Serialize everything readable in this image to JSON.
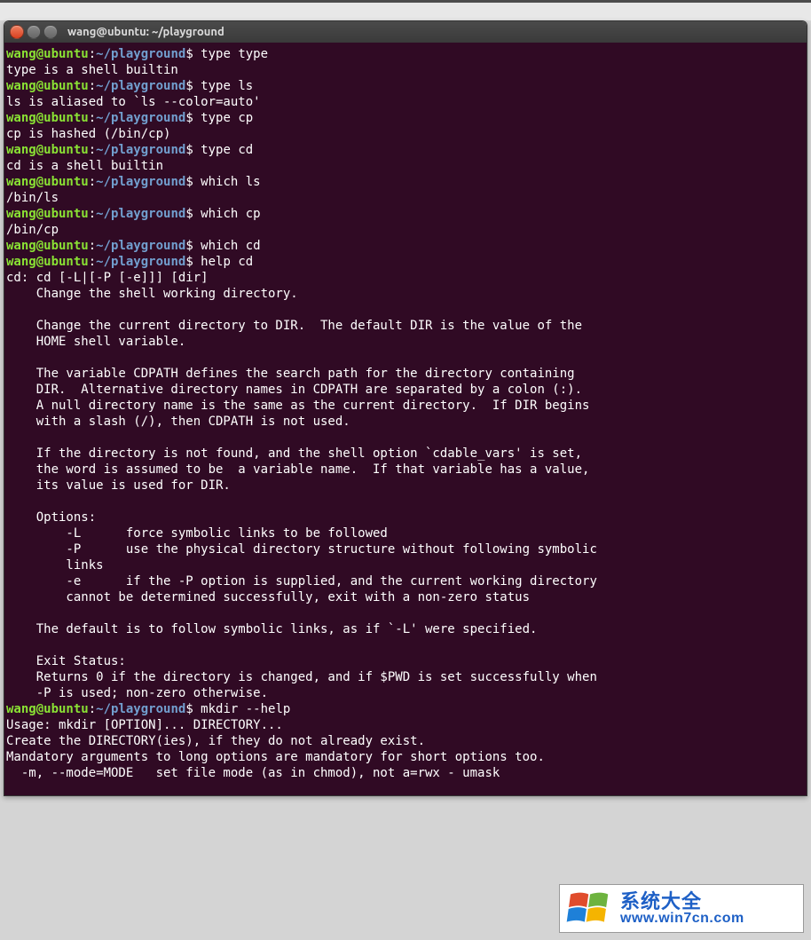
{
  "window": {
    "title": "wang@ubuntu: ~/playground"
  },
  "prompt": {
    "user_host": "wang@ubuntu",
    "colon": ":",
    "path": "~/playground",
    "symbol": "$"
  },
  "session": [
    {
      "type": "cmd",
      "text": "type type"
    },
    {
      "type": "out",
      "text": "type is a shell builtin"
    },
    {
      "type": "cmd",
      "text": "type ls"
    },
    {
      "type": "out",
      "text": "ls is aliased to `ls --color=auto'"
    },
    {
      "type": "cmd",
      "text": "type cp"
    },
    {
      "type": "out",
      "text": "cp is hashed (/bin/cp)"
    },
    {
      "type": "cmd",
      "text": "type cd"
    },
    {
      "type": "out",
      "text": "cd is a shell builtin"
    },
    {
      "type": "cmd",
      "text": "which ls"
    },
    {
      "type": "out",
      "text": "/bin/ls"
    },
    {
      "type": "cmd",
      "text": "which cp"
    },
    {
      "type": "out",
      "text": "/bin/cp"
    },
    {
      "type": "cmd",
      "text": "which cd"
    },
    {
      "type": "cmd",
      "text": "help cd"
    },
    {
      "type": "out",
      "text": "cd: cd [-L|[-P [-e]]] [dir]"
    },
    {
      "type": "out",
      "text": "    Change the shell working directory."
    },
    {
      "type": "out",
      "text": "    "
    },
    {
      "type": "out",
      "text": "    Change the current directory to DIR.  The default DIR is the value of the"
    },
    {
      "type": "out",
      "text": "    HOME shell variable."
    },
    {
      "type": "out",
      "text": "    "
    },
    {
      "type": "out",
      "text": "    The variable CDPATH defines the search path for the directory containing"
    },
    {
      "type": "out",
      "text": "    DIR.  Alternative directory names in CDPATH are separated by a colon (:)."
    },
    {
      "type": "out",
      "text": "    A null directory name is the same as the current directory.  If DIR begins"
    },
    {
      "type": "out",
      "text": "    with a slash (/), then CDPATH is not used."
    },
    {
      "type": "out",
      "text": "    "
    },
    {
      "type": "out",
      "text": "    If the directory is not found, and the shell option `cdable_vars' is set,"
    },
    {
      "type": "out",
      "text": "    the word is assumed to be  a variable name.  If that variable has a value,"
    },
    {
      "type": "out",
      "text": "    its value is used for DIR."
    },
    {
      "type": "out",
      "text": "    "
    },
    {
      "type": "out",
      "text": "    Options:"
    },
    {
      "type": "out",
      "text": "        -L      force symbolic links to be followed"
    },
    {
      "type": "out",
      "text": "        -P      use the physical directory structure without following symbolic"
    },
    {
      "type": "out",
      "text": "        links"
    },
    {
      "type": "out",
      "text": "        -e      if the -P option is supplied, and the current working directory"
    },
    {
      "type": "out",
      "text": "        cannot be determined successfully, exit with a non-zero status"
    },
    {
      "type": "out",
      "text": "    "
    },
    {
      "type": "out",
      "text": "    The default is to follow symbolic links, as if `-L' were specified."
    },
    {
      "type": "out",
      "text": "    "
    },
    {
      "type": "out",
      "text": "    Exit Status:"
    },
    {
      "type": "out",
      "text": "    Returns 0 if the directory is changed, and if $PWD is set successfully when"
    },
    {
      "type": "out",
      "text": "    -P is used; non-zero otherwise."
    },
    {
      "type": "cmd",
      "text": "mkdir --help"
    },
    {
      "type": "out",
      "text": "Usage: mkdir [OPTION]... DIRECTORY..."
    },
    {
      "type": "out",
      "text": "Create the DIRECTORY(ies), if they do not already exist."
    },
    {
      "type": "out",
      "text": ""
    },
    {
      "type": "out",
      "text": "Mandatory arguments to long options are mandatory for short options too."
    },
    {
      "type": "out",
      "text": "  -m, --mode=MODE   set file mode (as in chmod), not a=rwx - umask"
    }
  ],
  "watermark": {
    "cn": "系统大全",
    "url": "www.win7cn.com"
  }
}
